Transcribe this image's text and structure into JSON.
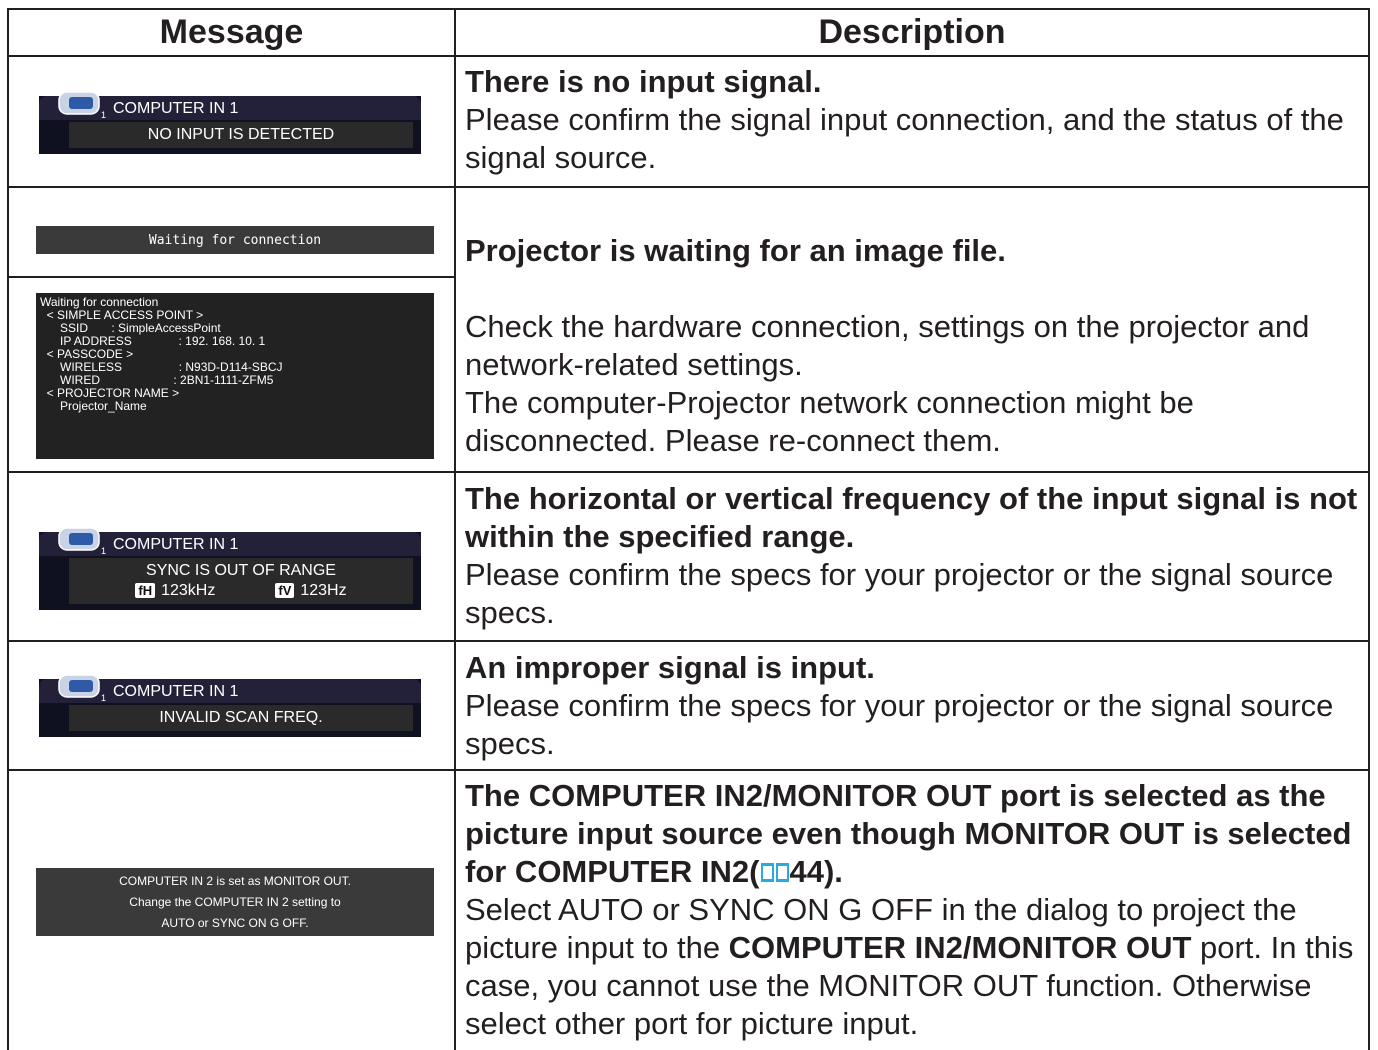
{
  "header": {
    "message": "Message",
    "description": "Description"
  },
  "rows": [
    {
      "osd": {
        "source": "COMPUTER IN 1",
        "message": "NO INPUT IS DETECTED"
      },
      "title": "There is no input signal.",
      "body": "Please confirm the signal input connection, and the status of the signal source."
    },
    {
      "waiting_bar": "Waiting for connection",
      "waiting_details": "Waiting for connection\n  < SIMPLE ACCESS POINT >\n      SSID       : SimpleAccessPoint\n      IP ADDRESS              : 192. 168. 10. 1\n  < PASSCODE >\n      WIRELESS                 : N93D-D114-SBCJ\n      WIRED                      : 2BN1-1111-ZFM5\n  < PROJECTOR NAME >\n      Projector_Name",
      "title": "Projector is waiting for an image file.",
      "body": "Check the hardware connection, settings on the projector and network-related settings.\nThe computer-Projector network connection might be disconnected. Please re-connect them."
    },
    {
      "osd": {
        "source": "COMPUTER IN 1",
        "message": "SYNC IS OUT OF RANGE",
        "fh_label": "fH",
        "fh_value": "123kHz",
        "fv_label": "fV",
        "fv_value": "123Hz"
      },
      "title": "The horizontal or vertical frequency of the input signal is not within the specified range.",
      "body": "Please confirm the specs for your projector or the signal source specs."
    },
    {
      "osd": {
        "source": "COMPUTER IN 1",
        "message": "INVALID SCAN FREQ."
      },
      "title": "An improper signal is input.",
      "body": "Please confirm the specs for your projector or the signal source specs."
    },
    {
      "monitor_lines": [
        "COMPUTER IN 2 is set as MONITOR OUT.",
        "Change the COMPUTER IN 2 setting to",
        "AUTO or SYNC ON G OFF."
      ],
      "title_1": "The COMPUTER IN2/MONITOR OUT port is selected as the picture input source even though MONITOR OUT is selected for COMPUTER IN2(",
      "title_ref": "44",
      "title_2": ").",
      "body_1": "Select AUTO or SYNC ON G OFF in the dialog to project the picture input to the ",
      "body_bold": "COMPUTER IN2/MONITOR OUT",
      "body_2": " port. In this case, you cannot use the MONITOR OUT function. Otherwise select other port for picture input."
    }
  ]
}
